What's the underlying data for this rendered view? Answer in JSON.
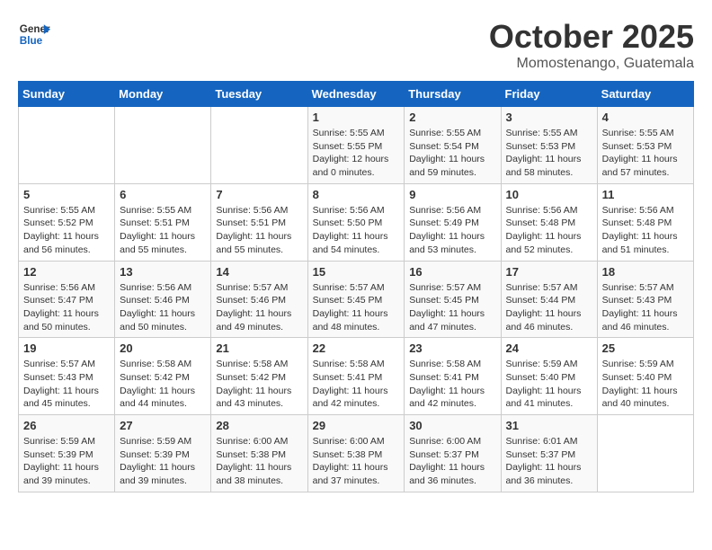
{
  "logo": {
    "line1": "General",
    "line2": "Blue"
  },
  "title": "October 2025",
  "location": "Momostenango, Guatemala",
  "weekdays": [
    "Sunday",
    "Monday",
    "Tuesday",
    "Wednesday",
    "Thursday",
    "Friday",
    "Saturday"
  ],
  "weeks": [
    [
      {
        "day": "",
        "info": ""
      },
      {
        "day": "",
        "info": ""
      },
      {
        "day": "",
        "info": ""
      },
      {
        "day": "1",
        "sunrise": "5:55 AM",
        "sunset": "5:55 PM",
        "daylight": "12 hours and 0 minutes."
      },
      {
        "day": "2",
        "sunrise": "5:55 AM",
        "sunset": "5:54 PM",
        "daylight": "11 hours and 59 minutes."
      },
      {
        "day": "3",
        "sunrise": "5:55 AM",
        "sunset": "5:53 PM",
        "daylight": "11 hours and 58 minutes."
      },
      {
        "day": "4",
        "sunrise": "5:55 AM",
        "sunset": "5:53 PM",
        "daylight": "11 hours and 57 minutes."
      }
    ],
    [
      {
        "day": "5",
        "sunrise": "5:55 AM",
        "sunset": "5:52 PM",
        "daylight": "11 hours and 56 minutes."
      },
      {
        "day": "6",
        "sunrise": "5:55 AM",
        "sunset": "5:51 PM",
        "daylight": "11 hours and 55 minutes."
      },
      {
        "day": "7",
        "sunrise": "5:56 AM",
        "sunset": "5:51 PM",
        "daylight": "11 hours and 55 minutes."
      },
      {
        "day": "8",
        "sunrise": "5:56 AM",
        "sunset": "5:50 PM",
        "daylight": "11 hours and 54 minutes."
      },
      {
        "day": "9",
        "sunrise": "5:56 AM",
        "sunset": "5:49 PM",
        "daylight": "11 hours and 53 minutes."
      },
      {
        "day": "10",
        "sunrise": "5:56 AM",
        "sunset": "5:48 PM",
        "daylight": "11 hours and 52 minutes."
      },
      {
        "day": "11",
        "sunrise": "5:56 AM",
        "sunset": "5:48 PM",
        "daylight": "11 hours and 51 minutes."
      }
    ],
    [
      {
        "day": "12",
        "sunrise": "5:56 AM",
        "sunset": "5:47 PM",
        "daylight": "11 hours and 50 minutes."
      },
      {
        "day": "13",
        "sunrise": "5:56 AM",
        "sunset": "5:46 PM",
        "daylight": "11 hours and 50 minutes."
      },
      {
        "day": "14",
        "sunrise": "5:57 AM",
        "sunset": "5:46 PM",
        "daylight": "11 hours and 49 minutes."
      },
      {
        "day": "15",
        "sunrise": "5:57 AM",
        "sunset": "5:45 PM",
        "daylight": "11 hours and 48 minutes."
      },
      {
        "day": "16",
        "sunrise": "5:57 AM",
        "sunset": "5:45 PM",
        "daylight": "11 hours and 47 minutes."
      },
      {
        "day": "17",
        "sunrise": "5:57 AM",
        "sunset": "5:44 PM",
        "daylight": "11 hours and 46 minutes."
      },
      {
        "day": "18",
        "sunrise": "5:57 AM",
        "sunset": "5:43 PM",
        "daylight": "11 hours and 46 minutes."
      }
    ],
    [
      {
        "day": "19",
        "sunrise": "5:57 AM",
        "sunset": "5:43 PM",
        "daylight": "11 hours and 45 minutes."
      },
      {
        "day": "20",
        "sunrise": "5:58 AM",
        "sunset": "5:42 PM",
        "daylight": "11 hours and 44 minutes."
      },
      {
        "day": "21",
        "sunrise": "5:58 AM",
        "sunset": "5:42 PM",
        "daylight": "11 hours and 43 minutes."
      },
      {
        "day": "22",
        "sunrise": "5:58 AM",
        "sunset": "5:41 PM",
        "daylight": "11 hours and 42 minutes."
      },
      {
        "day": "23",
        "sunrise": "5:58 AM",
        "sunset": "5:41 PM",
        "daylight": "11 hours and 42 minutes."
      },
      {
        "day": "24",
        "sunrise": "5:59 AM",
        "sunset": "5:40 PM",
        "daylight": "11 hours and 41 minutes."
      },
      {
        "day": "25",
        "sunrise": "5:59 AM",
        "sunset": "5:40 PM",
        "daylight": "11 hours and 40 minutes."
      }
    ],
    [
      {
        "day": "26",
        "sunrise": "5:59 AM",
        "sunset": "5:39 PM",
        "daylight": "11 hours and 39 minutes."
      },
      {
        "day": "27",
        "sunrise": "5:59 AM",
        "sunset": "5:39 PM",
        "daylight": "11 hours and 39 minutes."
      },
      {
        "day": "28",
        "sunrise": "6:00 AM",
        "sunset": "5:38 PM",
        "daylight": "11 hours and 38 minutes."
      },
      {
        "day": "29",
        "sunrise": "6:00 AM",
        "sunset": "5:38 PM",
        "daylight": "11 hours and 37 minutes."
      },
      {
        "day": "30",
        "sunrise": "6:00 AM",
        "sunset": "5:37 PM",
        "daylight": "11 hours and 36 minutes."
      },
      {
        "day": "31",
        "sunrise": "6:01 AM",
        "sunset": "5:37 PM",
        "daylight": "11 hours and 36 minutes."
      },
      {
        "day": "",
        "info": ""
      }
    ]
  ],
  "labels": {
    "sunrise": "Sunrise:",
    "sunset": "Sunset:",
    "daylight": "Daylight:"
  }
}
